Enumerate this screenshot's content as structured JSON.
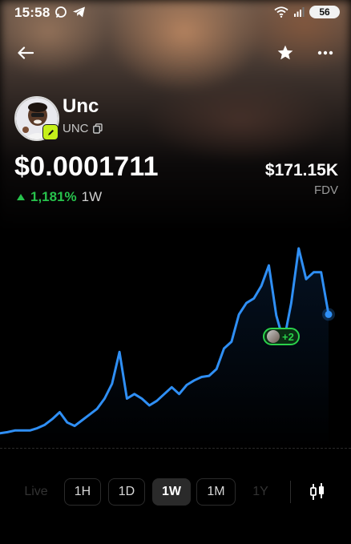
{
  "status_bar": {
    "time": "15:58",
    "battery": "56"
  },
  "token": {
    "name": "Unc",
    "symbol": "UNC",
    "price": "$0.0001711",
    "change": "1,181%",
    "change_period": "1W",
    "change_direction": "up",
    "fdv_value": "$171.15K",
    "fdv_label": "FDV"
  },
  "chart": {
    "marker_label": "+2",
    "series": [
      1.35e-06,
      1.45e-06,
      1.6e-06,
      1.6e-06,
      1.6e-06,
      1.8e-06,
      2.1e-06,
      2.6e-06,
      3.2e-06,
      2.3e-06,
      2e-06,
      2.5e-06,
      3e-06,
      3.5e-06,
      4.4e-06,
      5.7e-06,
      8.5e-06,
      4.4e-06,
      4.8e-06,
      4.4e-06,
      3.8e-06,
      4.2e-06,
      4.8e-06,
      5.4e-06,
      4.8e-06,
      5.6e-06,
      6e-06,
      6.3e-06,
      6.4e-06,
      7e-06,
      8.8e-06,
      9.4e-06,
      1.18e-05,
      1.28e-05,
      1.32e-05,
      1.43e-05,
      1.61e-05,
      1.17e-05,
      9.4e-06,
      1.28e-05,
      1.76e-05,
      1.49e-05,
      1.55e-05,
      1.55e-05,
      1.18e-05
    ],
    "colors": {
      "line": "#2f8ff5",
      "positive": "#27c24c",
      "marker": "#2ad14a"
    }
  },
  "timeframes": [
    {
      "label": "Live",
      "state": "disabled"
    },
    {
      "label": "1H",
      "state": "normal"
    },
    {
      "label": "1D",
      "state": "normal"
    },
    {
      "label": "1W",
      "state": "active"
    },
    {
      "label": "1M",
      "state": "normal"
    },
    {
      "label": "1Y",
      "state": "disabled"
    }
  ],
  "icons": {
    "back": "arrow-left-icon",
    "favorite": "star-icon",
    "more": "more-dots-icon",
    "copy": "copy-icon",
    "chain": "pencil-badge-icon",
    "chart_type": "candlestick-icon",
    "change": "triangle-up-icon"
  }
}
